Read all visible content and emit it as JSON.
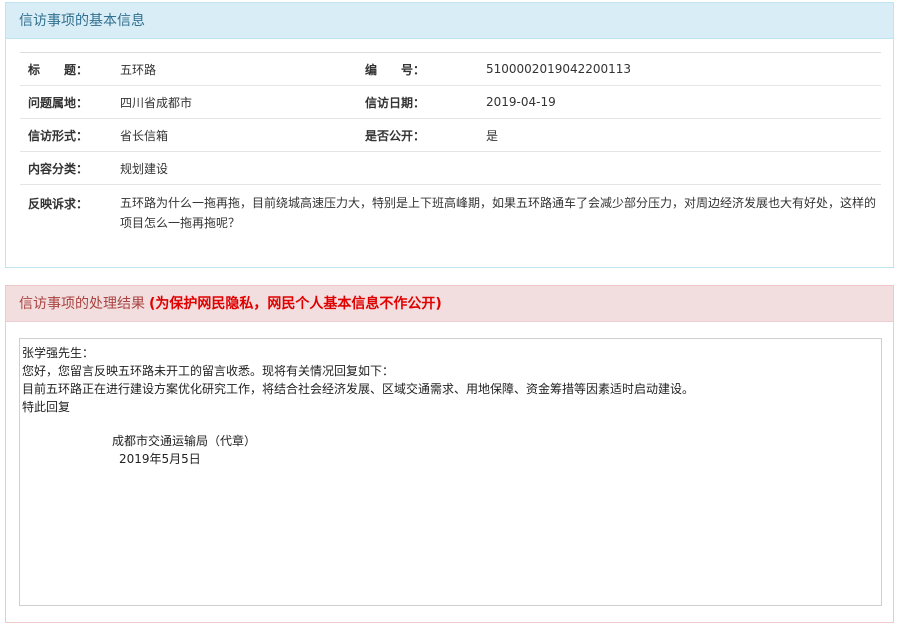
{
  "info_panel": {
    "header": "信访事项的基本信息",
    "rows": {
      "title_label": "标　　题：",
      "title_value": "五环路",
      "number_label": "编　　号：",
      "number_value": "5100002019042200113",
      "location_label": "问题属地：",
      "location_value": "四川省成都市",
      "date_label": "信访日期：",
      "date_value": "2019-04-19",
      "form_label": "信访形式：",
      "form_value": "省长信箱",
      "public_label": "是否公开：",
      "public_value": "是",
      "category_label": "内容分类：",
      "category_value": "规划建设",
      "appeal_label": "反映诉求：",
      "appeal_value": "五环路为什么一拖再拖，目前绕城高速压力大，特别是上下班高峰期，如果五环路通车了会减少部分压力，对周边经济发展也大有好处，这样的项目怎么一拖再拖呢？"
    }
  },
  "result_panel": {
    "header": "信访事项的处理结果",
    "privacy_notice": "(为保护网民隐私，网民个人基本信息不作公开)",
    "reply": {
      "salutation": "张学强先生：",
      "line1": "您好，您留言反映五环路未开工的留言收悉。现将有关情况回复如下：",
      "line2": "目前五环路正在进行建设方案优化研究工作，将结合社会经济发展、区域交通需求、用地保障、资金筹措等因素适时启动建设。",
      "line3": "特此回复",
      "signature": "成都市交通运输局（代章）",
      "sign_date": "2019年5月5日"
    }
  }
}
